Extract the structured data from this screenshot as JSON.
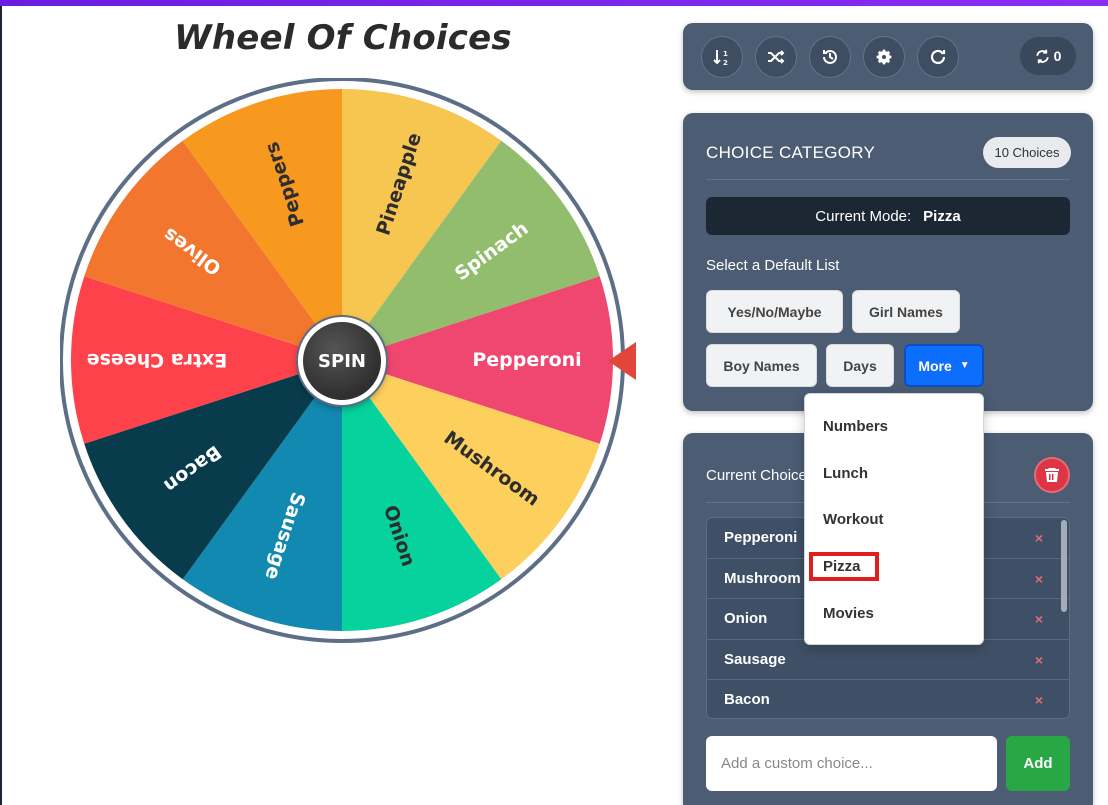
{
  "title": "Wheel Of Choices",
  "wheel": {
    "spin_label": "SPIN",
    "segments": [
      {
        "label": "Pepperoni",
        "color": "#ef4770"
      },
      {
        "label": "Mushroom",
        "color": "#fdd05d"
      },
      {
        "label": "Onion",
        "color": "#05d29c"
      },
      {
        "label": "Sausage",
        "color": "#1289b0"
      },
      {
        "label": "Bacon",
        "color": "#083b4c"
      },
      {
        "label": "Extra Cheese",
        "color": "#fe424b"
      },
      {
        "label": "Olives",
        "color": "#f3762f"
      },
      {
        "label": "Peppers",
        "color": "#f7981f"
      },
      {
        "label": "Pineapple",
        "color": "#f7c650"
      },
      {
        "label": "Spinach",
        "color": "#91bd6d"
      }
    ],
    "rim_color": "#5d6f87",
    "pointer_color": "#e2463a"
  },
  "toolbar": {
    "buttons": [
      {
        "name": "sort-button",
        "icon": "sort-numeric-icon"
      },
      {
        "name": "shuffle-button",
        "icon": "shuffle-icon"
      },
      {
        "name": "history-button",
        "icon": "history-icon"
      },
      {
        "name": "settings-button",
        "icon": "gear-icon"
      },
      {
        "name": "reset-button",
        "icon": "redo-icon"
      }
    ],
    "spin_count": "0"
  },
  "category": {
    "title": "CHOICE CATEGORY",
    "badge": "10 Choices",
    "mode_label": "Current Mode:",
    "mode_value": "Pizza",
    "select_label": "Select a Default List",
    "buttons": [
      "Yes/No/Maybe",
      "Girl Names",
      "Boy Names",
      "Days"
    ],
    "more_label": "More"
  },
  "dropdown": {
    "items": [
      "Numbers",
      "Lunch",
      "Workout",
      "Pizza",
      "Movies"
    ]
  },
  "current": {
    "title": "Current Choices",
    "items": [
      "Pepperoni",
      "Mushroom",
      "Onion",
      "Sausage",
      "Bacon"
    ],
    "remove_symbol": "×",
    "input_placeholder": "Add a custom choice...",
    "add_label": "Add"
  }
}
